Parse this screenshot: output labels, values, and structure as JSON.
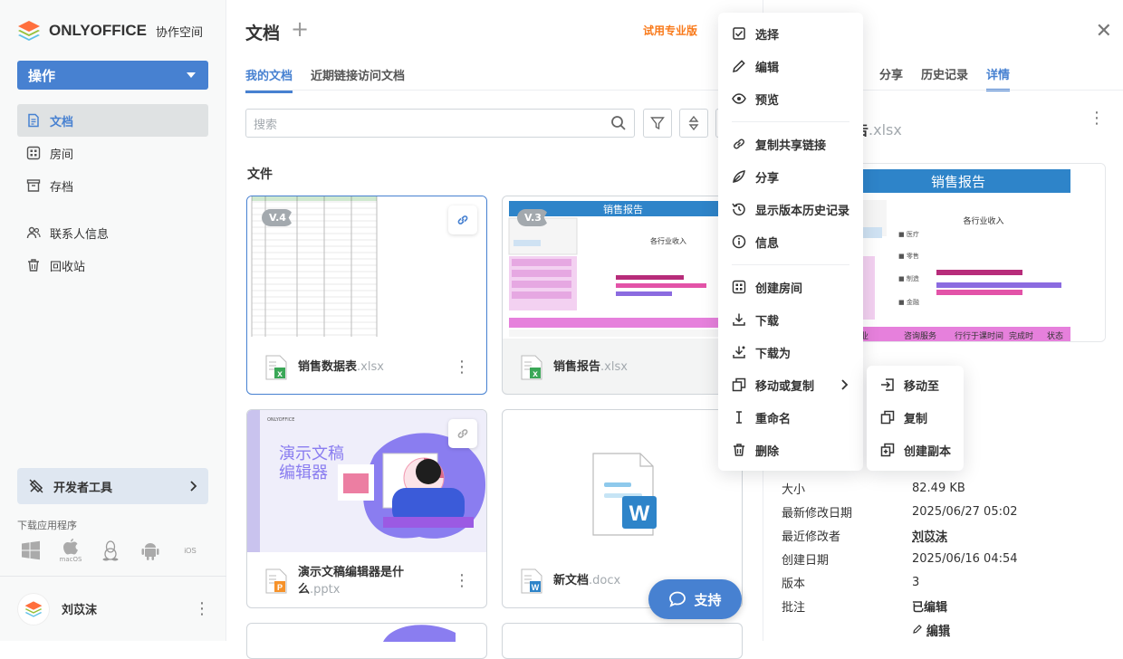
{
  "app": {
    "brand": "ONLYOFFICE",
    "brand_sub": "协作空间"
  },
  "sidebar": {
    "action_label": "操作",
    "items": [
      {
        "label": "文档",
        "icon": "document-icon",
        "active": true
      },
      {
        "label": "房间",
        "icon": "rooms-icon"
      },
      {
        "label": "存档",
        "icon": "archive-icon"
      },
      {
        "label": "联系人信息",
        "icon": "contacts-icon"
      },
      {
        "label": "回收站",
        "icon": "trash-icon"
      }
    ],
    "dev_tools": "开发者工具",
    "download_label": "下载应用程序",
    "platforms": [
      "windows-icon",
      "macos-icon",
      "linux-icon",
      "android-icon",
      "ios-icon"
    ],
    "macos_label": "macOS",
    "ios_label": "iOS",
    "user_name": "刘苡沫"
  },
  "header": {
    "title": "文档",
    "trial": "试用专业版"
  },
  "tabs": [
    "我的文档",
    "近期链接访问文档"
  ],
  "search": {
    "placeholder": "搜索"
  },
  "section_title": "文件",
  "files": [
    {
      "name": "销售数据表",
      "ext": ".xlsx",
      "version": "V.4",
      "type": "xlsx"
    },
    {
      "name": "销售报告",
      "ext": ".xlsx",
      "version": "V.3",
      "type": "xlsx"
    },
    {
      "name": "演示文稿编辑器是什么",
      "ext": ".pptx",
      "type": "pptx"
    },
    {
      "name": "新文档",
      "ext": ".docx",
      "type": "docx"
    }
  ],
  "thumbs": {
    "report_title": "销售报告",
    "report_chart_title": "各行业收入",
    "pptx_title_1": "演示文稿",
    "pptx_title_2": "编辑器",
    "pptx_brand": "ONLYOFFICE"
  },
  "support_label": "支持",
  "panel": {
    "tabs": [
      "分享",
      "历史记录",
      "详情"
    ],
    "file_name": "告",
    "file_ext": ".xlsx",
    "preview_title": "销售报告",
    "preview_chart_title": "各行业收入",
    "preview_footer": [
      "业",
      "咨询服务",
      "行行于课时间",
      "完成时",
      "状态"
    ],
    "props": [
      {
        "k": "大小",
        "v": "82.49 KB"
      },
      {
        "k": "最新修改日期",
        "v": "2025/06/27 05:02"
      },
      {
        "k": "最近修改者",
        "v": "刘苡沫"
      },
      {
        "k": "创建日期",
        "v": "2025/06/16 04:54"
      },
      {
        "k": "版本",
        "v": "3"
      },
      {
        "k": "批注",
        "v": "已编辑"
      }
    ],
    "edit_link": "编辑"
  },
  "context_menu": {
    "items": [
      "选择",
      "编辑",
      "预览",
      "复制共享链接",
      "分享",
      "显示版本历史记录",
      "信息",
      "创建房间",
      "下载",
      "下载为",
      "移动或复制",
      "重命名",
      "删除"
    ]
  },
  "submenu": {
    "items": [
      "移动至",
      "复制",
      "创建副本"
    ]
  }
}
